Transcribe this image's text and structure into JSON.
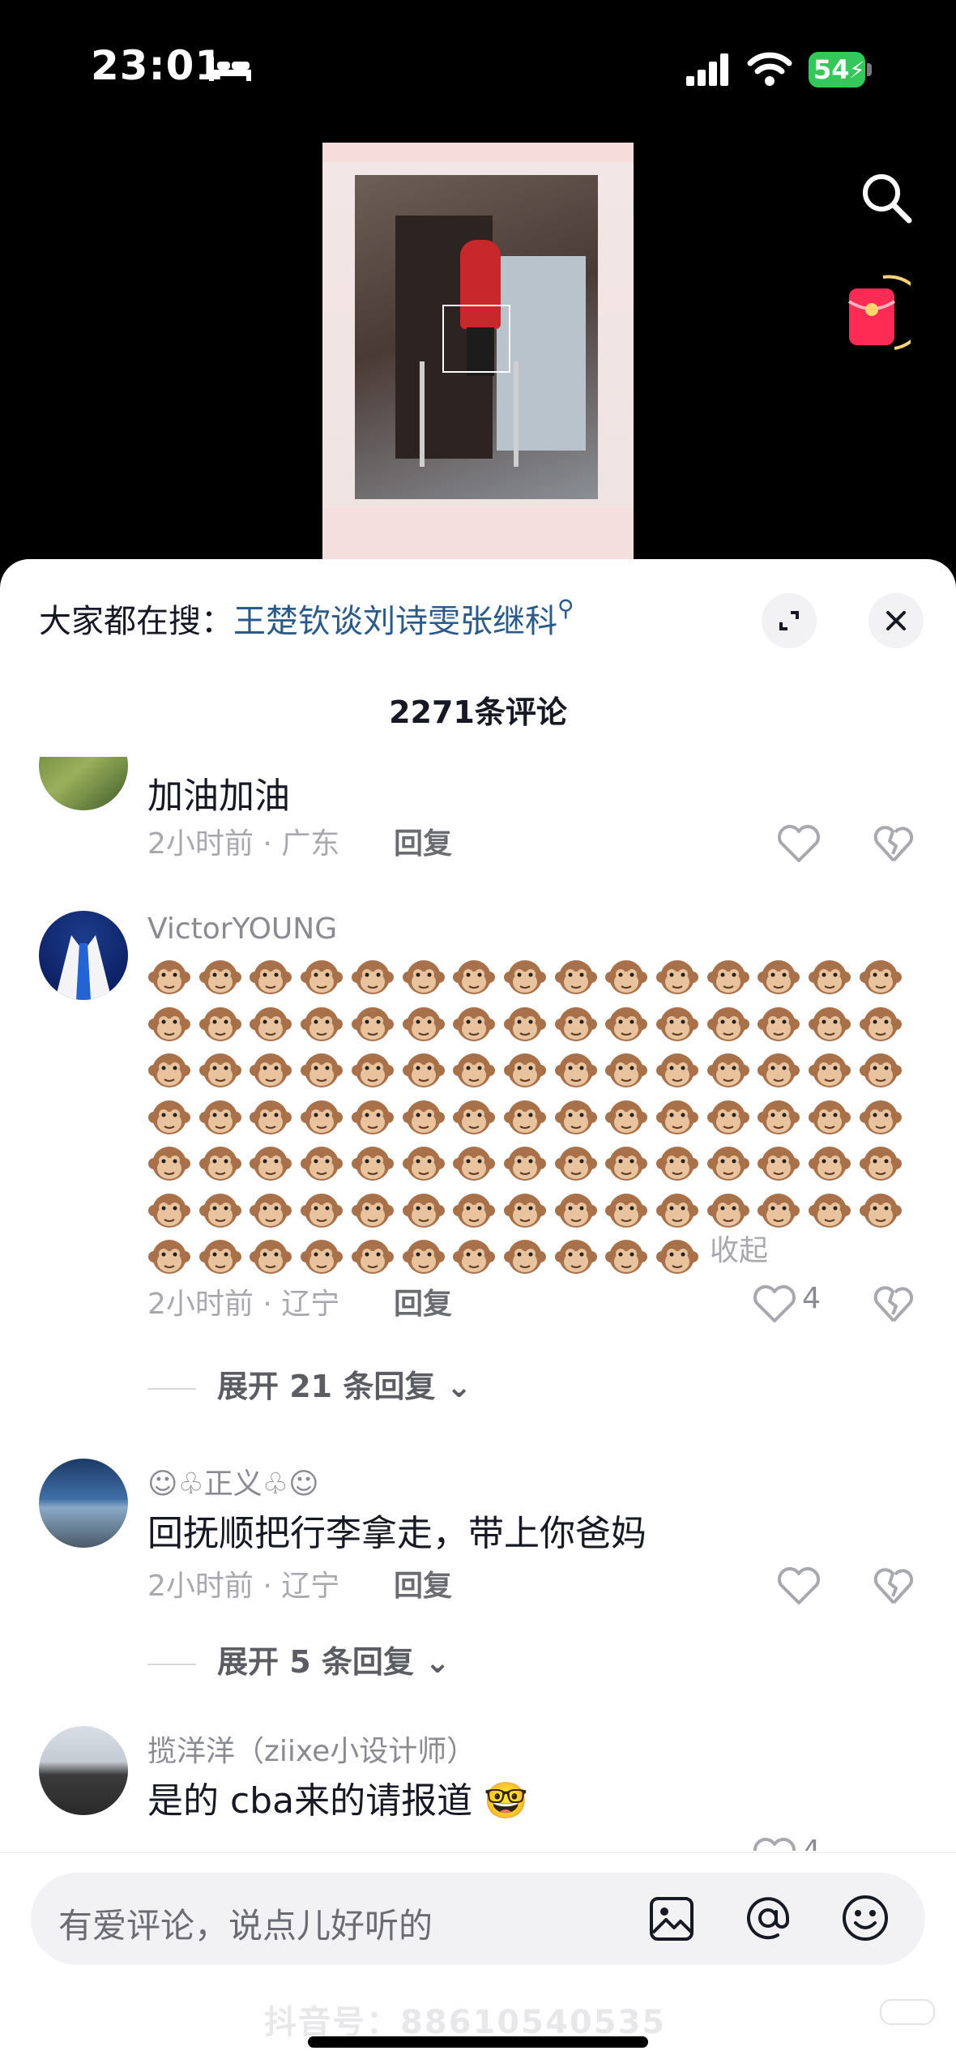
{
  "status_bar": {
    "time": "23:01",
    "battery": "54"
  },
  "sheet": {
    "hot_search_prefix": "大家都在搜：",
    "hot_search_keyword": "王楚钦谈刘诗雯张继科",
    "comment_count": "2271条评论"
  },
  "comments": [
    {
      "text": "加油加油",
      "meta": "2小时前 · 广东",
      "reply": "回复"
    },
    {
      "username": "VictorYOUNG",
      "meta": "2小时前 · 辽宁",
      "reply": "回复",
      "likes": "4",
      "collapse": "收起",
      "expand": "展开 21 条回复"
    },
    {
      "username": "☺︎♧正义♧☺︎",
      "text": "回抚顺把行李拿走，带上你爸妈",
      "meta": "2小时前 · 辽宁",
      "reply": "回复",
      "expand": "展开 5 条回复"
    },
    {
      "username": "揽洋洋（ziixe小设计师）",
      "text": "是的 cba来的请报道",
      "likes": "4"
    }
  ],
  "input": {
    "placeholder": "有爱评论，说点儿好听的"
  },
  "watermark": "抖音号：88610540535",
  "colors": {
    "keyword": "#2a5a8a",
    "battery": "#34c759",
    "redpacket": "#fe2c55"
  }
}
